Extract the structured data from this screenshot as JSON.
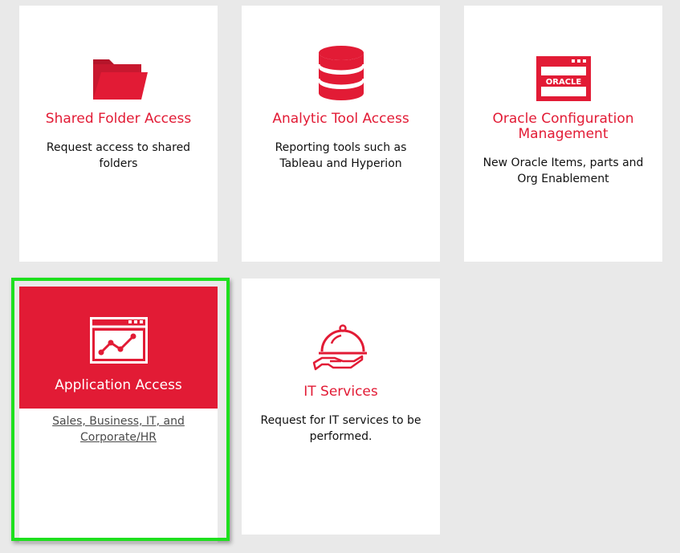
{
  "cards": [
    {
      "icon": "folder-icon",
      "title": "Shared Folder Access",
      "description": "Request access to shared folders"
    },
    {
      "icon": "database-icon",
      "title": "Analytic Tool Access",
      "description": "Reporting tools such as Tableau and Hyperion"
    },
    {
      "icon": "oracle-window-icon",
      "icon_text": "ORACLE",
      "title": "Oracle Configuration Management",
      "description": "New Oracle Items, parts and Org Enablement"
    },
    {
      "icon": "application-chart-icon",
      "title": "Application Access",
      "description": "Sales, Business, IT, and Corporate/HR",
      "selected": true
    },
    {
      "icon": "serving-tray-icon",
      "title": "IT Services",
      "description": "Request for IT services to be performed."
    }
  ],
  "colors": {
    "accent": "#e21b35",
    "background": "#e9e9e9",
    "card": "#ffffff",
    "highlight": "#1ee01e"
  }
}
